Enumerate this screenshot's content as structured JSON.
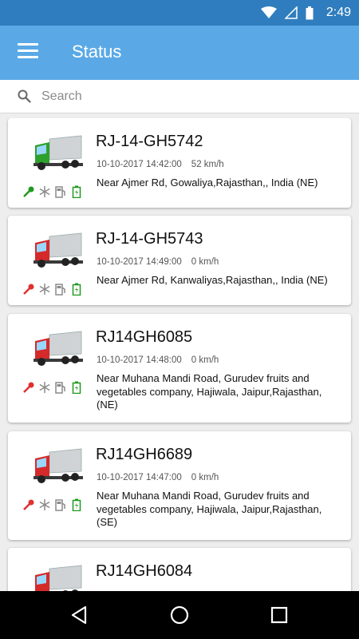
{
  "status_bar": {
    "time": "2:49",
    "icons": [
      "wifi-icon",
      "signal-icon",
      "battery-icon"
    ]
  },
  "app_bar": {
    "title": "Status",
    "menu_icon": "menu-icon"
  },
  "search": {
    "placeholder": "Search",
    "value": ""
  },
  "colors": {
    "status_bar": "#2f7dbe",
    "app_bar": "#5aa9e6",
    "ignition_on": "#1e9a1e",
    "ignition_off": "#e03030",
    "battery": "#1e9a1e",
    "inactive_icon": "#8a8a8a"
  },
  "vehicles": [
    {
      "number": "RJ-14-GH5742",
      "datetime": "10-10-2017 14:42:00",
      "speed": "52 km/h",
      "address": "Near Ajmer Rd,  Gowaliya,Rajasthan,, India (NE)",
      "truck_color": "green",
      "ignition": "on"
    },
    {
      "number": "RJ-14-GH5743",
      "datetime": "10-10-2017 14:49:00",
      "speed": "0 km/h",
      "address": "Near Ajmer Rd,  Kanwaliyas,Rajasthan,, India (NE)",
      "truck_color": "red",
      "ignition": "off"
    },
    {
      "number": "RJ14GH6085",
      "datetime": "10-10-2017 14:48:00",
      "speed": "0 km/h",
      "address": "Near Muhana Mandi Road, Gurudev fruits and vegetables company, Hajiwala, Jaipur,Rajasthan, (NE)",
      "truck_color": "red",
      "ignition": "off"
    },
    {
      "number": "RJ14GH6689",
      "datetime": "10-10-2017 14:47:00",
      "speed": "0 km/h",
      "address": "Near Muhana Mandi Road, Gurudev fruits and vegetables company, Hajiwala, Jaipur,Rajasthan, (SE)",
      "truck_color": "red",
      "ignition": "off"
    },
    {
      "number": "RJ14GH6084",
      "datetime": "",
      "speed": "",
      "address": "",
      "truck_color": "red",
      "ignition": "off"
    }
  ],
  "nav_bar": {
    "icons": [
      "back-icon",
      "home-icon",
      "recents-icon"
    ]
  }
}
